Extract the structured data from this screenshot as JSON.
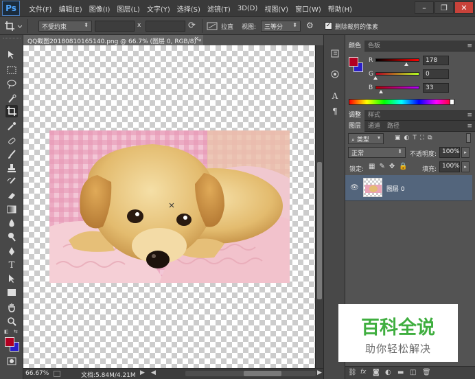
{
  "app": {
    "logo": "Ps"
  },
  "menu": [
    "文件(F)",
    "编辑(E)",
    "图像(I)",
    "图层(L)",
    "文字(Y)",
    "选择(S)",
    "滤镜(T)",
    "3D(D)",
    "视图(V)",
    "窗口(W)",
    "帮助(H)"
  ],
  "window_controls": {
    "minimize": "–",
    "restore": "❐",
    "close": "✕"
  },
  "options": {
    "ratio_select": "不受约束",
    "times_sign": "x",
    "straighten_label": "拉直",
    "view_label": "视图:",
    "view_select": "三等分",
    "delete_cropped_label": "删除裁剪的像素",
    "delete_cropped_checked": true
  },
  "document": {
    "tab_title": "QQ截图20180810165140.png @ 66.7% (图层 0, RGB/8) *",
    "close_glyph": "×",
    "zoom": "66.67%",
    "doc_info": "文档:5.84M/4.21M"
  },
  "color_panel": {
    "tabs": [
      "颜色",
      "色板"
    ],
    "active_tab": "颜色",
    "R": 178,
    "G": 0,
    "B": 33,
    "foreground": "#b20021",
    "background": "#2a1fc8"
  },
  "adjust_panel": {
    "tabs": [
      "调整",
      "样式"
    ],
    "active_tab": "调整"
  },
  "layers_panel": {
    "tabs": [
      "图层",
      "通道",
      "路径"
    ],
    "active_tab": "图层",
    "filter_kind": "类型",
    "blend_mode": "正常",
    "opacity_label": "不透明度:",
    "opacity": "100%",
    "lock_label": "锁定:",
    "fill_label": "填充:",
    "fill": "100%",
    "layers": [
      {
        "name": "图层 0",
        "visible": true,
        "selected": true
      }
    ]
  },
  "watermark": {
    "title": "百科全说",
    "subtitle": "助你轻松解决"
  },
  "colors": {
    "accent_layer_row": "#53657c",
    "watermark_green": "#3fae3f"
  }
}
